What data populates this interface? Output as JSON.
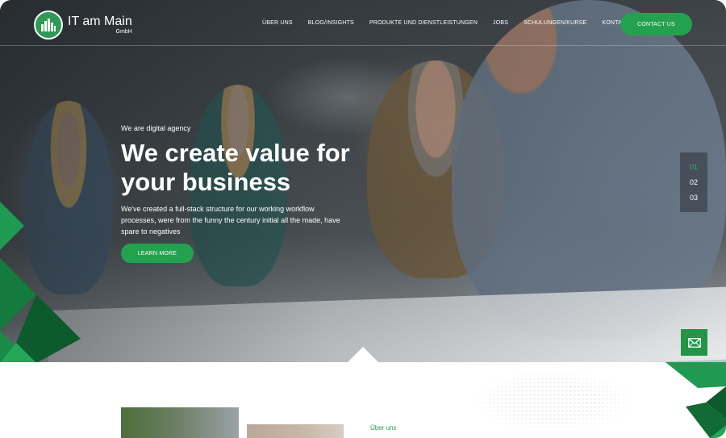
{
  "brand": {
    "name": "IT am Main",
    "sub": "GmbH",
    "accent_color": "#24a14e"
  },
  "nav": {
    "items": [
      {
        "label": "ÜBER UNS"
      },
      {
        "label": "BLOG/INSIGHTS"
      },
      {
        "label": "PRODUKTE UND DIENSTLEISTUNGEN"
      },
      {
        "label": "JOBS"
      },
      {
        "label": "SCHULUNGEN/KURSE"
      },
      {
        "label": "KONTAKT"
      }
    ],
    "cta_label": "CONTACT US"
  },
  "hero": {
    "kicker": "We are digital agency",
    "headline": "We create value for your business",
    "description": "We've created a full-stack structure for our working workflow processes, were from the funny the century initial all the made, have spare to negatives",
    "button_label": "LEARN MORE"
  },
  "slider": {
    "items": [
      "01",
      "02",
      "03"
    ],
    "active_index": 0
  },
  "floating": {
    "icon": "mail-icon"
  },
  "section": {
    "label": "Über uns"
  }
}
